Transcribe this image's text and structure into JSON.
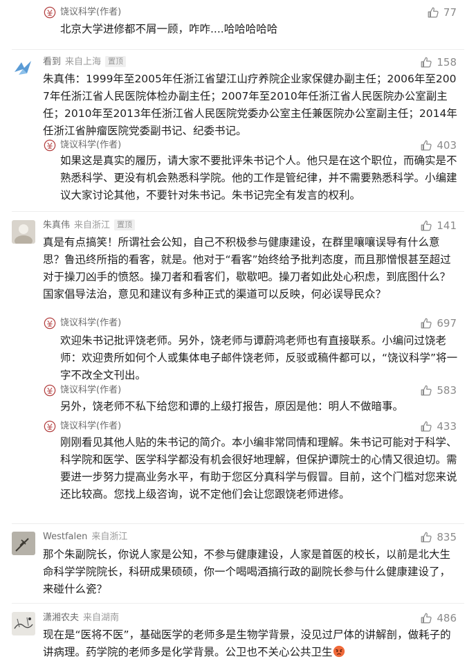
{
  "comments": [
    {
      "replies": [
        {
          "author": "饶议科学(作者)",
          "likes": "77",
          "text": "北京大学进修都不屑一顾，咋咋....哈哈哈哈哈"
        }
      ]
    },
    {
      "author": "看到",
      "location": "来自上海",
      "pinned": "置顶",
      "likes": "158",
      "text": "朱真伟：1999年至2005年任浙江省望江山疗养院企业家保健办副主任；2006年至2007年任浙江省人民医院体检办副主任；2007年至2010年任浙江省人民医院办公室副主任；2010年至2013年任浙江省人民医院党委办公室主任兼医院办公室副主任；2014年任浙江省肿瘤医院党委副书记、纪委书记。",
      "replies": [
        {
          "author": "饶议科学(作者)",
          "likes": "403",
          "text": "如果这是真实的履历，请大家不要批评朱书记个人。他只是在这个职位，而确实是不熟悉科学、更没有机会熟悉科学院。他的工作是管纪律，并不需要熟悉科学。小编建议大家讨论其他，不要针对朱书记。朱书记完全有发言的权利。"
        }
      ]
    },
    {
      "author": "朱真伟",
      "location": "来自浙江",
      "pinned": "置顶",
      "likes": "141",
      "text": "真是有点搞笑！所谓社会公知，自己不积极参与健康建设，在群里嚷嚷误导有什么意思？鲁迅终所指的看客，就是。他对于“看客”始终给予批判态度，而且那憎恨甚至超过对于操刀凶手的愤怒。操刀者和看客们，歇歇吧。操刀者如此处心积虑，到底图什么？国家倡导法治，意见和建议有多种正式的渠道可以反映，何必误导民众？",
      "replies": [
        {
          "author": "饶议科学(作者)",
          "likes": "697",
          "text": "欢迎朱书记批评饶老师。另外，饶老师与谭蔚鸿老师也有直接联系。小编问过饶老师：欢迎贵所如何个人或集体电子邮件饶老师，反驳或稿件都可以，“饶议科学”将一字不改全文刊出。"
        },
        {
          "author": "饶议科学(作者)",
          "likes": "583",
          "text": "另外，饶老师不私下给您和谭的上级打报告，原因是他：明人不做暗事。"
        },
        {
          "author": "饶议科学(作者)",
          "likes": "433",
          "text": "刚刚看见其他人贴的朱书记的简介。本小编非常同情和理解。朱书记可能对于科学、科学院和医学、医学科学都没有机会很好地理解，但保护谭院士的心情又很迫切。需要进一步努力提高业务水平，有助于您区分真科学与假冒。目前，这个门槛对您来说还比较高。您找上级咨询，说不定他们会让您跟饶老师进修。"
        }
      ]
    },
    {
      "author": "Westfalen",
      "location": "来自浙江",
      "likes": "835",
      "text": "那个朱副院长，你说人家是公知，不参与健康建设，人家是首医的校长，以前是北大生命科学学院院长，科研成果硕硕，你一个喝喝酒搞行政的副院长参与什么健康建设了，来碰什么瓷？"
    },
    {
      "author": "潇湘农夫",
      "location": "来自湖南",
      "likes": "486",
      "text": "现在是“医将不医”，基础医学的老师多是生物学背景，没见过尸体的讲解剖，做耗子的讲病理。药学院的老师多是化学背景。公卫也不关心公共卫生",
      "emoji": "angry-face-icon"
    }
  ]
}
